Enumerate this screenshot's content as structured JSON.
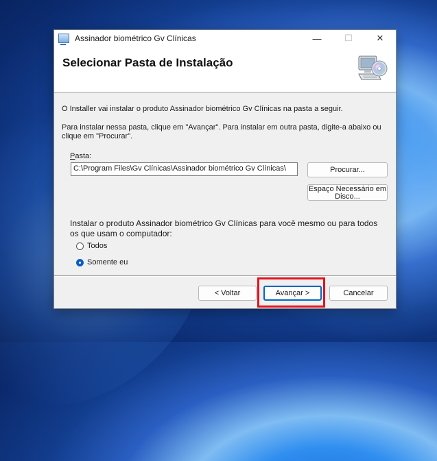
{
  "window": {
    "title": "Assinador biométrico Gv Clínicas",
    "controls": {
      "minimize": "—",
      "maximize": "☐",
      "close": "✕"
    }
  },
  "header": {
    "title": "Selecionar Pasta de Instalação",
    "icon": "computer-cd-icon"
  },
  "body": {
    "intro": "O Installer vai instalar o produto Assinador biométrico Gv Clínicas na pasta a seguir.",
    "instructions_line1": "Para instalar nessa pasta, clique em \"Avançar\". Para instalar em outra pasta, digite-a abaixo ou",
    "instructions_line2": "clique em \"Procurar\".",
    "folder_label_underlined": "P",
    "folder_label_rest": "asta:",
    "folder_value": "C:\\Program Files\\Gv Clínicas\\Assinador biométrico Gv Clínicas\\",
    "browse_label": "Procurar...",
    "disk_space_line1": "Espaço Necessário em",
    "disk_space_line2": "Disco...",
    "question_line1": "Instalar o produto Assinador biométrico Gv Clínicas para você mesmo ou para todos",
    "question_line2": "os que usam o computador:",
    "options": [
      {
        "label": "Todos",
        "selected": false
      },
      {
        "label": "Somente eu",
        "selected": true
      }
    ]
  },
  "footer": {
    "back_label": "< Voltar",
    "next_label": "Avançar >",
    "cancel_label": "Cancelar"
  },
  "colors": {
    "highlight": "#e0131f",
    "accent": "#0067c0"
  }
}
